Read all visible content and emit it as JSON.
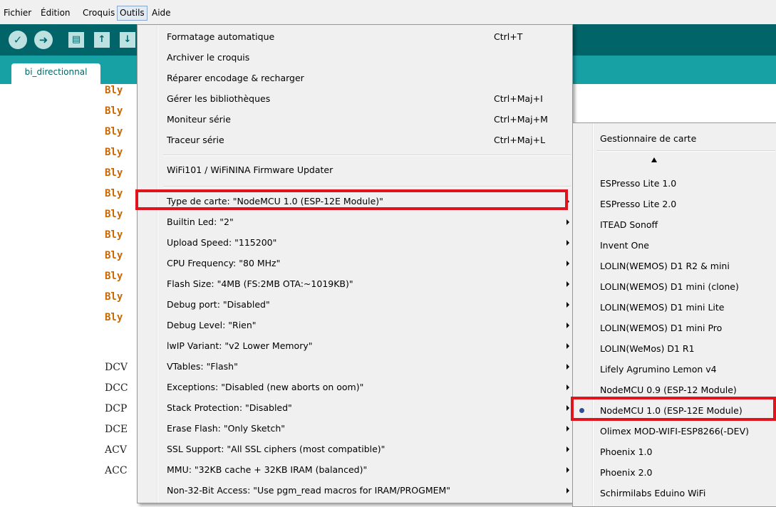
{
  "menubar": [
    "Fichier",
    "Édition",
    "Croquis",
    "Outils",
    "Aide"
  ],
  "toolbar": {
    "verify_icon": "check-icon",
    "upload_icon": "arrow-right-icon",
    "new_icon": "page-icon",
    "open_icon": "arrow-up-icon",
    "save_icon": "arrow-down-icon"
  },
  "tab": {
    "label": "bi_directionnal"
  },
  "code_lines": [
    "Bly",
    "Bly",
    "Bly",
    "Bly",
    "Bly",
    "Bly",
    "Bly",
    "Bly",
    "Bly",
    "Bly",
    "Bly",
    "Bly"
  ],
  "code_lines2": [
    "DCV",
    "DCC",
    "DCP",
    "DCE",
    "ACV",
    "ACC"
  ],
  "tools_menu": {
    "group1": [
      {
        "label": "Formatage automatique",
        "shortcut": "Ctrl+T"
      },
      {
        "label": "Archiver le croquis",
        "shortcut": ""
      },
      {
        "label": "Réparer encodage & recharger",
        "shortcut": ""
      },
      {
        "label": "Gérer les bibliothèques",
        "shortcut": "Ctrl+Maj+I"
      },
      {
        "label": "Moniteur série",
        "shortcut": "Ctrl+Maj+M"
      },
      {
        "label": "Traceur série",
        "shortcut": "Ctrl+Maj+L"
      }
    ],
    "firmware": "WiFi101 / WiFiNINA Firmware Updater",
    "options": [
      "Type de carte: \"NodeMCU 1.0 (ESP-12E Module)\"",
      "Builtin Led: \"2\"",
      "Upload Speed: \"115200\"",
      "CPU Frequency: \"80 MHz\"",
      "Flash Size: \"4MB (FS:2MB OTA:~1019KB)\"",
      "Debug port: \"Disabled\"",
      "Debug Level: \"Rien\"",
      "lwIP Variant: \"v2 Lower Memory\"",
      "VTables: \"Flash\"",
      "Exceptions: \"Disabled (new aborts on oom)\"",
      "Stack Protection: \"Disabled\"",
      "Erase Flash: \"Only Sketch\"",
      "SSL Support: \"All SSL ciphers (most compatible)\"",
      "MMU: \"32KB cache + 32KB IRAM (balanced)\"",
      "Non-32-Bit Access: \"Use pgm_read macros for IRAM/PROGMEM\""
    ]
  },
  "board_menu": {
    "header": "Gestionnaire de carte",
    "scroll_icon": "triangle-up-icon",
    "boards": [
      "ESPresso Lite 1.0",
      "ESPresso Lite 2.0",
      "ITEAD Sonoff",
      "Invent One",
      "LOLIN(WEMOS) D1 R2 & mini",
      "LOLIN(WEMOS) D1 mini (clone)",
      "LOLIN(WEMOS) D1 mini Lite",
      "LOLIN(WEMOS) D1 mini Pro",
      "LOLIN(WeMos) D1 R1",
      "Lifely Agrumino Lemon v4",
      "NodeMCU 0.9 (ESP-12 Module)",
      "NodeMCU 1.0 (ESP-12E Module)",
      "Olimex MOD-WIFI-ESP8266(-DEV)",
      "Phoenix 1.0",
      "Phoenix 2.0",
      "Schirmilabs Eduino WiFi"
    ],
    "selected": "NodeMCU 1.0 (ESP-12E Module)"
  },
  "colors": {
    "toolbar": "#006468",
    "tabbar": "#17a1a5",
    "highlight": "#e0141c",
    "keyword": "#cc6600"
  }
}
